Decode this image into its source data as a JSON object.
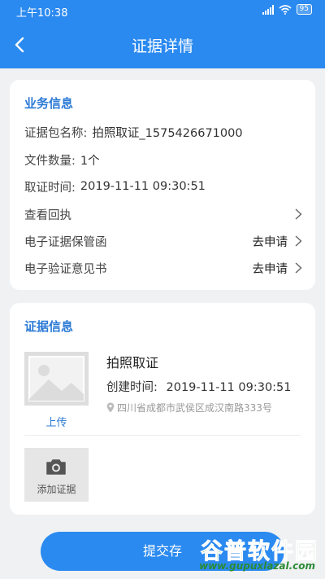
{
  "status": {
    "time": "上午10:38",
    "battery": "95"
  },
  "nav": {
    "title": "证据详情"
  },
  "business": {
    "title": "业务信息",
    "package_label": "证据包名称:",
    "package_value": "拍照取证_1575426671000",
    "count_label": "文件数量:",
    "count_value": "1个",
    "time_label": "取证时间:",
    "time_value": "2019-11-11 09:30:51",
    "receipt": "查看回执",
    "custody_letter": "电子证据保管函",
    "custody_action": "去申请",
    "opinion_letter": "电子验证意见书",
    "opinion_action": "去申请"
  },
  "evidence": {
    "title": "证据信息",
    "upload": "上传",
    "item_title": "拍照取证",
    "created_label": "创建时间:",
    "created_value": "2019-11-11 09:30:51",
    "location": "四川省成都市武侯区成汉南路333号",
    "add_label": "添加证据"
  },
  "footer": {
    "submit": "提交存"
  },
  "watermark": {
    "main": "谷普软件园",
    "sub": "www.gupuxlazal.com"
  },
  "colors": {
    "primary": "#2b8af0",
    "link": "#2b7ad6",
    "watermark": "#2b8a34"
  }
}
